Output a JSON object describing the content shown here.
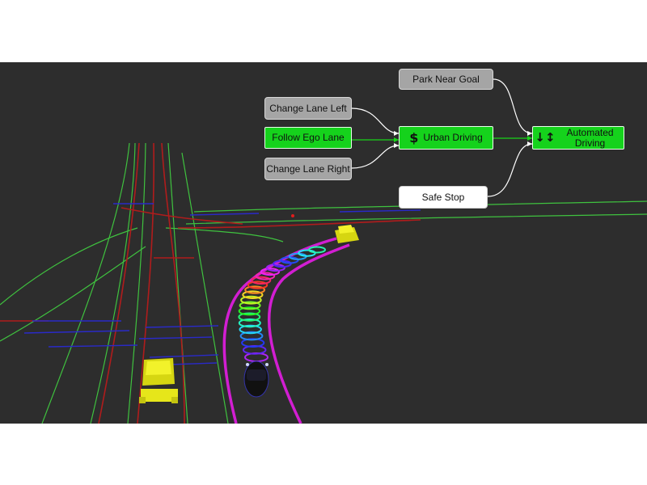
{
  "behavior_tree": {
    "nodes": {
      "park_near_goal": {
        "label": "Park Near Goal",
        "state": "inactive"
      },
      "change_lane_left": {
        "label": "Change Lane Left",
        "state": "inactive"
      },
      "follow_ego_lane": {
        "label": "Follow Ego Lane",
        "state": "active"
      },
      "change_lane_right": {
        "label": "Change Lane Right",
        "state": "inactive"
      },
      "urban_driving": {
        "label": "Urban Driving",
        "icon": "dollar-sign-icon",
        "state": "active"
      },
      "automated_driving": {
        "label": "Automated Driving",
        "icon": "sort-arrows-icon",
        "state": "active"
      },
      "safe_stop": {
        "label": "Safe Stop",
        "state": "idle"
      }
    },
    "colors": {
      "active": "#15d21c",
      "inactive": "#a5a5a5",
      "idle": "#ffffff",
      "background": "#2d2d2d",
      "corridor": "#d21ed2",
      "lane_line_green": "#3fc23f",
      "lane_line_red": "#b01c1c",
      "lane_line_blue": "#2a2ac8",
      "vehicle_other": "#e8e81a"
    }
  },
  "scene": {
    "ego_vehicle": "ego-car",
    "other_vehicles": [
      "vehicle-near-left",
      "vehicle-far-ahead"
    ],
    "trajectory": "colored-ring-trajectory"
  }
}
